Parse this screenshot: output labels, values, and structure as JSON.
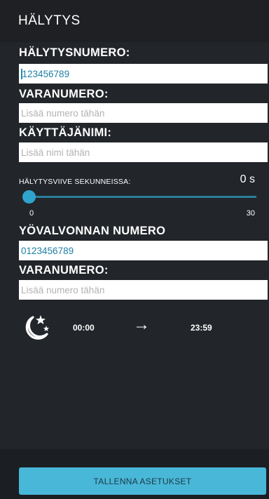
{
  "appbar": {
    "title": "HÄLYTYS"
  },
  "alarm_number": {
    "label": "HÄLYTYSNUMERO:",
    "value": "123456789"
  },
  "backup_number": {
    "label": "VARANUMERO:",
    "placeholder": "Lisää numero tähän"
  },
  "username": {
    "label": "KÄYTTÄJÄNIMI:",
    "placeholder": "Lisää nimi tähän"
  },
  "delay": {
    "label": "HÄLYTYSVIIVE SEKUNNEISSA:",
    "value_text": "0 s",
    "value": 0,
    "min_label": "0",
    "max_label": "30",
    "min": 0,
    "max": 30
  },
  "night_number": {
    "label": "YÖVALVONNAN NUMERO",
    "value": "0123456789"
  },
  "night_backup_number": {
    "label": "VARANUMERO:",
    "placeholder": "Lisää numero tähän"
  },
  "night_schedule": {
    "icon": "moon-stars-icon",
    "start": "00:00",
    "arrow": "→",
    "end": "23:59"
  },
  "save_button": {
    "label": "TALLENNA ASETUKSET"
  },
  "colors": {
    "accent": "#49b7d8",
    "background": "#1b1e23",
    "value_text": "#1f7fa3"
  }
}
